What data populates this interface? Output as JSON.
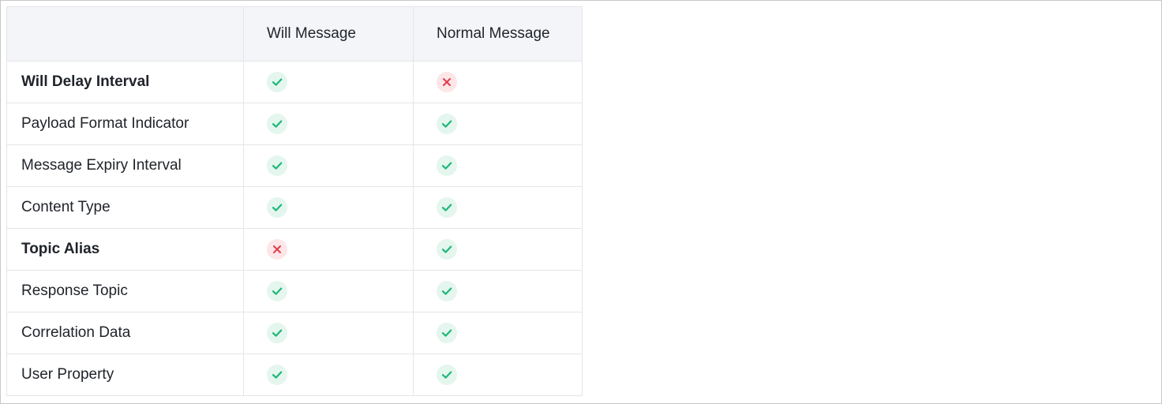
{
  "table": {
    "columns": [
      "",
      "Will Message",
      "Normal Message"
    ],
    "rows": [
      {
        "label": "Will Delay Interval",
        "bold": true,
        "will": "yes",
        "normal": "no"
      },
      {
        "label": "Payload Format Indicator",
        "bold": false,
        "will": "yes",
        "normal": "yes"
      },
      {
        "label": "Message Expiry Interval",
        "bold": false,
        "will": "yes",
        "normal": "yes"
      },
      {
        "label": "Content Type",
        "bold": false,
        "will": "yes",
        "normal": "yes"
      },
      {
        "label": "Topic Alias",
        "bold": true,
        "will": "no",
        "normal": "yes"
      },
      {
        "label": "Response Topic",
        "bold": false,
        "will": "yes",
        "normal": "yes"
      },
      {
        "label": "Correlation Data",
        "bold": false,
        "will": "yes",
        "normal": "yes"
      },
      {
        "label": "User Property",
        "bold": false,
        "will": "yes",
        "normal": "yes"
      }
    ]
  },
  "icons": {
    "yes": "check-icon",
    "no": "cross-icon"
  },
  "colors": {
    "yes_fg": "#1db878",
    "yes_bg": "#e4f6ee",
    "no_fg": "#e5394a",
    "no_bg": "#fce6e8",
    "header_bg": "#f4f5f8",
    "border": "#e4e6ea"
  }
}
